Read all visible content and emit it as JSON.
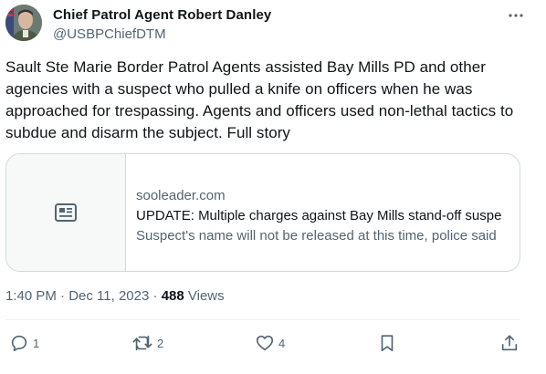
{
  "author": {
    "display_name": "Chief Patrol Agent Robert Danley",
    "handle": "@USBPChiefDTM"
  },
  "tweet": {
    "text": "Sault Ste Marie Border Patrol Agents assisted Bay Mills PD and other agencies with a suspect who pulled a knife on officers when he was approached for trespassing. Agents and officers used non-lethal tactics to subdue and disarm the subject. Full story"
  },
  "link_card": {
    "domain": "sooleader.com",
    "title": "UPDATE: Multiple charges against Bay Mills stand-off suspe",
    "description": "Suspect's name will not be released at this time, police said",
    "thumbnail_icon": "article-icon"
  },
  "meta": {
    "time": "1:40 PM",
    "separator1": " · ",
    "date": "Dec 11, 2023",
    "separator2": " · ",
    "views_count": "488",
    "views_label": " Views"
  },
  "actions": {
    "reply_count": "1",
    "retweet_count": "2",
    "like_count": "4"
  },
  "icons": {
    "more": "more-icon",
    "reply": "reply-icon",
    "retweet": "retweet-icon",
    "like": "heart-icon",
    "bookmark": "bookmark-icon",
    "share": "share-icon"
  },
  "colors": {
    "text_primary": "#0f1419",
    "text_secondary": "#536471",
    "border": "#cfd9de"
  }
}
